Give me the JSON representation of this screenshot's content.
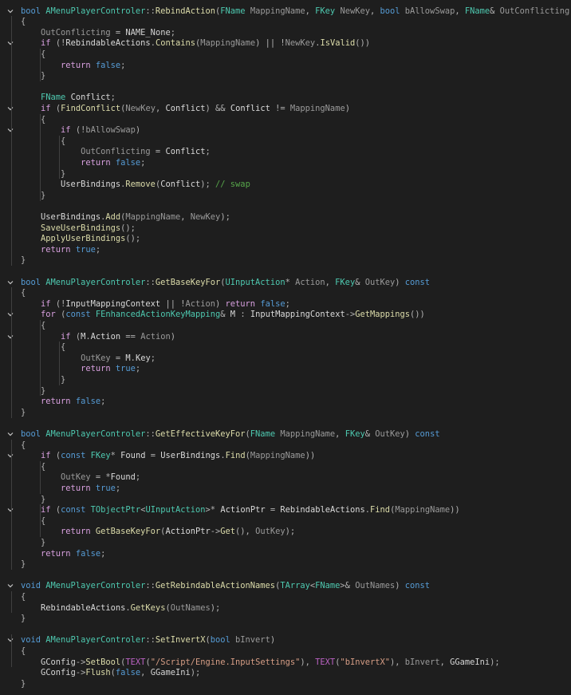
{
  "theme": {
    "background": "#1e1e1e",
    "keyword": "#569cd6",
    "control_keyword": "#d8a0df",
    "type": "#4ec9b0",
    "function": "#dcdcaa",
    "parameter": "#9a9a9a",
    "string": "#d69d85",
    "comment": "#57a64a",
    "guide": "#404040"
  },
  "fold_icon": "chevron-down-icon",
  "code_lines": [
    {
      "fold": true,
      "tokens": [
        [
          "kw",
          "bool "
        ],
        [
          "type",
          "AMenuPlayerControler"
        ],
        [
          "op",
          "::"
        ],
        [
          "fn",
          "RebindAction"
        ],
        [
          "op",
          "("
        ],
        [
          "type",
          "FName "
        ],
        [
          "param",
          "MappingName"
        ],
        [
          "op",
          ", "
        ],
        [
          "type",
          "FKey "
        ],
        [
          "param",
          "NewKey"
        ],
        [
          "op",
          ", "
        ],
        [
          "kw",
          "bool "
        ],
        [
          "param",
          "bAllowSwap"
        ],
        [
          "op",
          ", "
        ],
        [
          "type",
          "FName"
        ],
        [
          "op",
          "& "
        ],
        [
          "param",
          "OutConflicting"
        ],
        [
          "op",
          ")"
        ]
      ]
    },
    {
      "tokens": [
        [
          "op",
          "{"
        ]
      ]
    },
    {
      "tokens": [
        [
          "op",
          "    "
        ],
        [
          "param",
          "OutConflicting"
        ],
        [
          "op",
          " = "
        ],
        [
          "plain",
          "NAME_None"
        ],
        [
          "op",
          ";"
        ]
      ]
    },
    {
      "fold": true,
      "tokens": [
        [
          "op",
          "    "
        ],
        [
          "ctl",
          "if "
        ],
        [
          "op",
          "(!"
        ],
        [
          "mem",
          "RebindableActions"
        ],
        [
          "op",
          "."
        ],
        [
          "fn",
          "Contains"
        ],
        [
          "op",
          "("
        ],
        [
          "param",
          "MappingName"
        ],
        [
          "op",
          ") || !"
        ],
        [
          "param",
          "NewKey"
        ],
        [
          "op",
          "."
        ],
        [
          "fn",
          "IsValid"
        ],
        [
          "op",
          "())"
        ]
      ]
    },
    {
      "tokens": [
        [
          "op",
          "    {"
        ]
      ]
    },
    {
      "tokens": [
        [
          "op",
          "        "
        ],
        [
          "ctl",
          "return "
        ],
        [
          "kw",
          "false"
        ],
        [
          "op",
          ";"
        ]
      ]
    },
    {
      "tokens": [
        [
          "op",
          "    }"
        ]
      ]
    },
    {
      "tokens": []
    },
    {
      "tokens": [
        [
          "op",
          "    "
        ],
        [
          "type",
          "FName "
        ],
        [
          "var",
          "Conflict"
        ],
        [
          "op",
          ";"
        ]
      ]
    },
    {
      "fold": true,
      "tokens": [
        [
          "op",
          "    "
        ],
        [
          "ctl",
          "if "
        ],
        [
          "op",
          "("
        ],
        [
          "fn",
          "FindConflict"
        ],
        [
          "op",
          "("
        ],
        [
          "param",
          "NewKey"
        ],
        [
          "op",
          ", "
        ],
        [
          "var",
          "Conflict"
        ],
        [
          "op",
          ") && "
        ],
        [
          "var",
          "Conflict"
        ],
        [
          "op",
          " != "
        ],
        [
          "param",
          "MappingName"
        ],
        [
          "op",
          ")"
        ]
      ]
    },
    {
      "tokens": [
        [
          "op",
          "    {"
        ]
      ]
    },
    {
      "fold": true,
      "tokens": [
        [
          "op",
          "        "
        ],
        [
          "ctl",
          "if "
        ],
        [
          "op",
          "(!"
        ],
        [
          "param",
          "bAllowSwap"
        ],
        [
          "op",
          ")"
        ]
      ]
    },
    {
      "tokens": [
        [
          "op",
          "        {"
        ]
      ]
    },
    {
      "tokens": [
        [
          "op",
          "            "
        ],
        [
          "param",
          "OutConflicting"
        ],
        [
          "op",
          " = "
        ],
        [
          "var",
          "Conflict"
        ],
        [
          "op",
          ";"
        ]
      ]
    },
    {
      "tokens": [
        [
          "op",
          "            "
        ],
        [
          "ctl",
          "return "
        ],
        [
          "kw",
          "false"
        ],
        [
          "op",
          ";"
        ]
      ]
    },
    {
      "tokens": [
        [
          "op",
          "        }"
        ]
      ]
    },
    {
      "tokens": [
        [
          "op",
          "        "
        ],
        [
          "mem",
          "UserBindings"
        ],
        [
          "op",
          "."
        ],
        [
          "fn",
          "Remove"
        ],
        [
          "op",
          "("
        ],
        [
          "var",
          "Conflict"
        ],
        [
          "op",
          "); "
        ],
        [
          "cmt",
          "// swap"
        ]
      ]
    },
    {
      "tokens": [
        [
          "op",
          "    }"
        ]
      ]
    },
    {
      "tokens": []
    },
    {
      "tokens": [
        [
          "op",
          "    "
        ],
        [
          "mem",
          "UserBindings"
        ],
        [
          "op",
          "."
        ],
        [
          "fn",
          "Add"
        ],
        [
          "op",
          "("
        ],
        [
          "param",
          "MappingName"
        ],
        [
          "op",
          ", "
        ],
        [
          "param",
          "NewKey"
        ],
        [
          "op",
          ");"
        ]
      ]
    },
    {
      "tokens": [
        [
          "op",
          "    "
        ],
        [
          "fn",
          "SaveUserBindings"
        ],
        [
          "op",
          "();"
        ]
      ]
    },
    {
      "tokens": [
        [
          "op",
          "    "
        ],
        [
          "fn",
          "ApplyUserBindings"
        ],
        [
          "op",
          "();"
        ]
      ]
    },
    {
      "tokens": [
        [
          "op",
          "    "
        ],
        [
          "ctl",
          "return "
        ],
        [
          "kw",
          "true"
        ],
        [
          "op",
          ";"
        ]
      ]
    },
    {
      "tokens": [
        [
          "op",
          "}"
        ]
      ]
    },
    {
      "tokens": []
    },
    {
      "fold": true,
      "tokens": [
        [
          "kw",
          "bool "
        ],
        [
          "type",
          "AMenuPlayerControler"
        ],
        [
          "op",
          "::"
        ],
        [
          "fn",
          "GetBaseKeyFor"
        ],
        [
          "op",
          "("
        ],
        [
          "type",
          "UInputAction"
        ],
        [
          "op",
          "* "
        ],
        [
          "param",
          "Action"
        ],
        [
          "op",
          ", "
        ],
        [
          "type",
          "FKey"
        ],
        [
          "op",
          "& "
        ],
        [
          "param",
          "OutKey"
        ],
        [
          "op",
          ") "
        ],
        [
          "kw",
          "const"
        ]
      ]
    },
    {
      "tokens": [
        [
          "op",
          "{"
        ]
      ]
    },
    {
      "tokens": [
        [
          "op",
          "    "
        ],
        [
          "ctl",
          "if "
        ],
        [
          "op",
          "(!"
        ],
        [
          "mem",
          "InputMappingContext"
        ],
        [
          "op",
          " || !"
        ],
        [
          "param",
          "Action"
        ],
        [
          "op",
          ") "
        ],
        [
          "ctl",
          "return "
        ],
        [
          "kw",
          "false"
        ],
        [
          "op",
          ";"
        ]
      ]
    },
    {
      "fold": true,
      "tokens": [
        [
          "op",
          "    "
        ],
        [
          "ctl",
          "for "
        ],
        [
          "op",
          "("
        ],
        [
          "kw",
          "const "
        ],
        [
          "type",
          "FEnhancedActionKeyMapping"
        ],
        [
          "op",
          "& "
        ],
        [
          "var",
          "M"
        ],
        [
          "op",
          " : "
        ],
        [
          "mem",
          "InputMappingContext"
        ],
        [
          "op",
          "->"
        ],
        [
          "fn",
          "GetMappings"
        ],
        [
          "op",
          "())"
        ]
      ]
    },
    {
      "tokens": [
        [
          "op",
          "    {"
        ]
      ]
    },
    {
      "fold": true,
      "tokens": [
        [
          "op",
          "        "
        ],
        [
          "ctl",
          "if "
        ],
        [
          "op",
          "("
        ],
        [
          "var",
          "M"
        ],
        [
          "op",
          "."
        ],
        [
          "mem",
          "Action"
        ],
        [
          "op",
          " == "
        ],
        [
          "param",
          "Action"
        ],
        [
          "op",
          ")"
        ]
      ]
    },
    {
      "tokens": [
        [
          "op",
          "        {"
        ]
      ]
    },
    {
      "tokens": [
        [
          "op",
          "            "
        ],
        [
          "param",
          "OutKey"
        ],
        [
          "op",
          " = "
        ],
        [
          "var",
          "M"
        ],
        [
          "op",
          "."
        ],
        [
          "mem",
          "Key"
        ],
        [
          "op",
          ";"
        ]
      ]
    },
    {
      "tokens": [
        [
          "op",
          "            "
        ],
        [
          "ctl",
          "return "
        ],
        [
          "kw",
          "true"
        ],
        [
          "op",
          ";"
        ]
      ]
    },
    {
      "tokens": [
        [
          "op",
          "        }"
        ]
      ]
    },
    {
      "tokens": [
        [
          "op",
          "    }"
        ]
      ]
    },
    {
      "tokens": [
        [
          "op",
          "    "
        ],
        [
          "ctl",
          "return "
        ],
        [
          "kw",
          "false"
        ],
        [
          "op",
          ";"
        ]
      ]
    },
    {
      "tokens": [
        [
          "op",
          "}"
        ]
      ]
    },
    {
      "tokens": []
    },
    {
      "fold": true,
      "tokens": [
        [
          "kw",
          "bool "
        ],
        [
          "type",
          "AMenuPlayerControler"
        ],
        [
          "op",
          "::"
        ],
        [
          "fn",
          "GetEffectiveKeyFor"
        ],
        [
          "op",
          "("
        ],
        [
          "type",
          "FName "
        ],
        [
          "param",
          "MappingName"
        ],
        [
          "op",
          ", "
        ],
        [
          "type",
          "FKey"
        ],
        [
          "op",
          "& "
        ],
        [
          "param",
          "OutKey"
        ],
        [
          "op",
          ") "
        ],
        [
          "kw",
          "const"
        ]
      ]
    },
    {
      "tokens": [
        [
          "op",
          "{"
        ]
      ]
    },
    {
      "fold": true,
      "tokens": [
        [
          "op",
          "    "
        ],
        [
          "ctl",
          "if "
        ],
        [
          "op",
          "("
        ],
        [
          "kw",
          "const "
        ],
        [
          "type",
          "FKey"
        ],
        [
          "op",
          "* "
        ],
        [
          "var",
          "Found"
        ],
        [
          "op",
          " = "
        ],
        [
          "mem",
          "UserBindings"
        ],
        [
          "op",
          "."
        ],
        [
          "fn",
          "Find"
        ],
        [
          "op",
          "("
        ],
        [
          "param",
          "MappingName"
        ],
        [
          "op",
          "))"
        ]
      ]
    },
    {
      "tokens": [
        [
          "op",
          "    {"
        ]
      ]
    },
    {
      "tokens": [
        [
          "op",
          "        "
        ],
        [
          "param",
          "OutKey"
        ],
        [
          "op",
          " = *"
        ],
        [
          "var",
          "Found"
        ],
        [
          "op",
          ";"
        ]
      ]
    },
    {
      "tokens": [
        [
          "op",
          "        "
        ],
        [
          "ctl",
          "return "
        ],
        [
          "kw",
          "true"
        ],
        [
          "op",
          ";"
        ]
      ]
    },
    {
      "tokens": [
        [
          "op",
          "    }"
        ]
      ]
    },
    {
      "fold": true,
      "tokens": [
        [
          "op",
          "    "
        ],
        [
          "ctl",
          "if "
        ],
        [
          "op",
          "("
        ],
        [
          "kw",
          "const "
        ],
        [
          "type",
          "TObjectPtr"
        ],
        [
          "op",
          "<"
        ],
        [
          "type",
          "UInputAction"
        ],
        [
          "op",
          ">* "
        ],
        [
          "var",
          "ActionPtr"
        ],
        [
          "op",
          " = "
        ],
        [
          "mem",
          "RebindableActions"
        ],
        [
          "op",
          "."
        ],
        [
          "fn",
          "Find"
        ],
        [
          "op",
          "("
        ],
        [
          "param",
          "MappingName"
        ],
        [
          "op",
          "))"
        ]
      ]
    },
    {
      "tokens": [
        [
          "op",
          "    {"
        ]
      ]
    },
    {
      "tokens": [
        [
          "op",
          "        "
        ],
        [
          "ctl",
          "return "
        ],
        [
          "fn",
          "GetBaseKeyFor"
        ],
        [
          "op",
          "("
        ],
        [
          "var",
          "ActionPtr"
        ],
        [
          "op",
          "->"
        ],
        [
          "fn",
          "Get"
        ],
        [
          "op",
          "(), "
        ],
        [
          "param",
          "OutKey"
        ],
        [
          "op",
          ");"
        ]
      ]
    },
    {
      "tokens": [
        [
          "op",
          "    }"
        ]
      ]
    },
    {
      "tokens": [
        [
          "op",
          "    "
        ],
        [
          "ctl",
          "return "
        ],
        [
          "kw",
          "false"
        ],
        [
          "op",
          ";"
        ]
      ]
    },
    {
      "tokens": [
        [
          "op",
          "}"
        ]
      ]
    },
    {
      "tokens": []
    },
    {
      "fold": true,
      "tokens": [
        [
          "kw",
          "void "
        ],
        [
          "type",
          "AMenuPlayerControler"
        ],
        [
          "op",
          "::"
        ],
        [
          "fn",
          "GetRebindableActionNames"
        ],
        [
          "op",
          "("
        ],
        [
          "type",
          "TArray"
        ],
        [
          "op",
          "<"
        ],
        [
          "type",
          "FName"
        ],
        [
          "op",
          ">& "
        ],
        [
          "param",
          "OutNames"
        ],
        [
          "op",
          ") "
        ],
        [
          "kw",
          "const"
        ]
      ]
    },
    {
      "tokens": [
        [
          "op",
          "{"
        ]
      ]
    },
    {
      "tokens": [
        [
          "op",
          "    "
        ],
        [
          "mem",
          "RebindableActions"
        ],
        [
          "op",
          "."
        ],
        [
          "fn",
          "GetKeys"
        ],
        [
          "op",
          "("
        ],
        [
          "param",
          "OutNames"
        ],
        [
          "op",
          ");"
        ]
      ]
    },
    {
      "tokens": [
        [
          "op",
          "}"
        ]
      ]
    },
    {
      "tokens": []
    },
    {
      "fold": true,
      "tokens": [
        [
          "kw",
          "void "
        ],
        [
          "type",
          "AMenuPlayerControler"
        ],
        [
          "op",
          "::"
        ],
        [
          "fn",
          "SetInvertX"
        ],
        [
          "op",
          "("
        ],
        [
          "kw",
          "bool "
        ],
        [
          "param",
          "bInvert"
        ],
        [
          "op",
          ")"
        ]
      ]
    },
    {
      "tokens": [
        [
          "op",
          "{"
        ]
      ]
    },
    {
      "tokens": [
        [
          "op",
          "    "
        ],
        [
          "plain",
          "GConfig"
        ],
        [
          "op",
          "->"
        ],
        [
          "fn",
          "SetBool"
        ],
        [
          "op",
          "("
        ],
        [
          "macro",
          "TEXT"
        ],
        [
          "op",
          "("
        ],
        [
          "str",
          "\"/Script/Engine.InputSettings\""
        ],
        [
          "op",
          "), "
        ],
        [
          "macro",
          "TEXT"
        ],
        [
          "op",
          "("
        ],
        [
          "str",
          "\"bInvertX\""
        ],
        [
          "op",
          "), "
        ],
        [
          "param",
          "bInvert"
        ],
        [
          "op",
          ", "
        ],
        [
          "plain",
          "GGameIni"
        ],
        [
          "op",
          ");"
        ]
      ]
    },
    {
      "tokens": [
        [
          "op",
          "    "
        ],
        [
          "plain",
          "GConfig"
        ],
        [
          "op",
          "->"
        ],
        [
          "fn",
          "Flush"
        ],
        [
          "op",
          "("
        ],
        [
          "kw",
          "false"
        ],
        [
          "op",
          ", "
        ],
        [
          "plain",
          "GGameIni"
        ],
        [
          "op",
          ");"
        ]
      ]
    },
    {
      "tokens": [
        [
          "op",
          "}"
        ]
      ]
    }
  ]
}
